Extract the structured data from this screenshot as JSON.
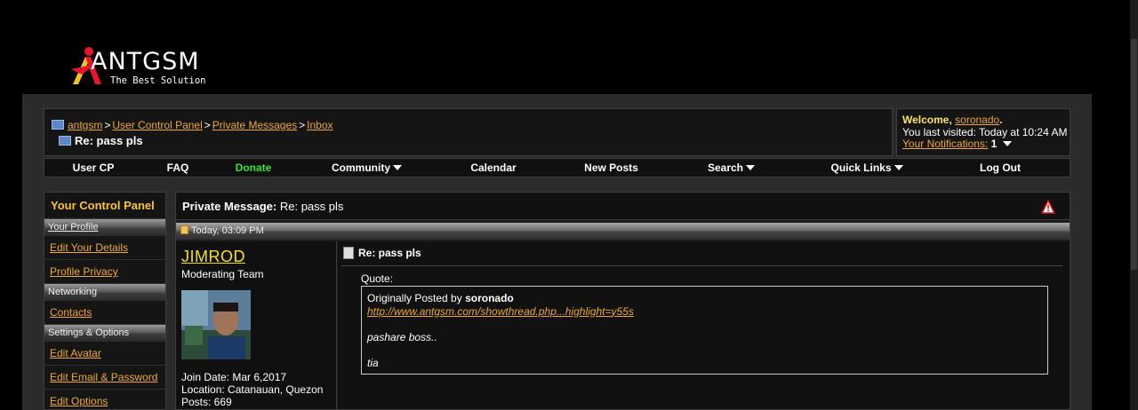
{
  "logo": {
    "name": "ANTGSM",
    "tagline": "The Best Solution"
  },
  "breadcrumb": {
    "items": [
      "antgsm",
      "User Control Panel",
      "Private Messages",
      "Inbox"
    ],
    "separator": ">",
    "current": "Re: pass pls"
  },
  "welcome": {
    "prefix": "Welcome,",
    "username": "soronado",
    "suffix": ".",
    "last_visited": "You last visited: Today at 10:24 AM",
    "notifications_label": "Your Notifications:",
    "notifications_count": "1"
  },
  "nav": [
    {
      "label": "User CP",
      "dropdown": false
    },
    {
      "label": "FAQ",
      "dropdown": false
    },
    {
      "label": "Donate",
      "dropdown": false
    },
    {
      "label": "Community",
      "dropdown": true
    },
    {
      "label": "Calendar",
      "dropdown": false
    },
    {
      "label": "New Posts",
      "dropdown": false
    },
    {
      "label": "Search",
      "dropdown": true
    },
    {
      "label": "Quick Links",
      "dropdown": true
    },
    {
      "label": "Log Out",
      "dropdown": false
    }
  ],
  "control_panel": {
    "title": "Your Control Panel",
    "sections": {
      "profile": "Your Profile",
      "networking": "Networking",
      "settings": "Settings & Options"
    },
    "items": {
      "edit_details": "Edit Your Details",
      "profile_privacy": "Profile Privacy",
      "contacts": "Contacts",
      "edit_avatar": "Edit Avatar",
      "edit_email": "Edit Email & Password",
      "edit_options": "Edit Options"
    }
  },
  "message": {
    "header_label": "Private Message:",
    "header_title": "Re: pass pls",
    "date": "Today, 03:09 PM",
    "title": "Re: pass pls",
    "quote_label": "Quote:",
    "quote_prefix": "Originally Posted by",
    "quote_author": "soronado",
    "quote_link": "http://www.antgsm.com/showthread.php...highlight=y55s",
    "quote_line1": "pashare boss..",
    "quote_line2": "tia"
  },
  "author": {
    "name": "JIMROD",
    "title": "Moderating Team",
    "join_date": "Join Date: Mar 6,2017",
    "location": "Location: Catanauan, Quezon",
    "posts": "Posts: 669"
  },
  "colors": {
    "accent_link": "#f0a830",
    "username_yellow": "#f7e017",
    "panel_title": "#f7c334",
    "donate_green": "#33e433"
  }
}
